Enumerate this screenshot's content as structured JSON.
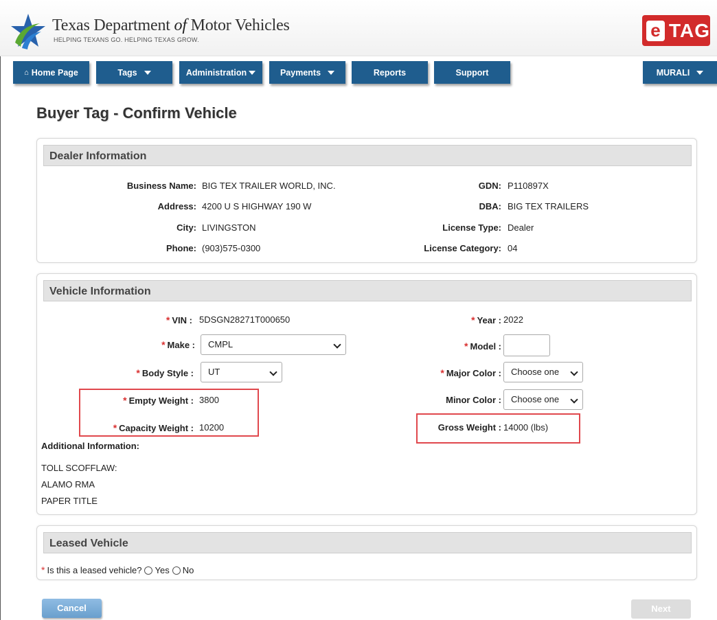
{
  "header": {
    "title_part1": "Texas Department ",
    "title_of": "of",
    "title_part2": " Motor Vehicles",
    "tagline": "HELPING TEXANS GO. HELPING TEXAS GROW.",
    "etag_e": "e",
    "etag_text": "TAG"
  },
  "nav": {
    "home": "Home Page",
    "home_icon": "⌂",
    "tags": "Tags",
    "administration": "Administration",
    "payments": "Payments",
    "reports": "Reports",
    "support": "Support",
    "user": "MURALI"
  },
  "page": {
    "title": "Buyer Tag - Confirm Vehicle"
  },
  "dealer": {
    "heading": "Dealer Information",
    "business_name_label": "Business Name:",
    "business_name": "BIG TEX TRAILER WORLD, INC.",
    "address_label": "Address:",
    "address": "4200 U S HIGHWAY 190 W",
    "city_label": "City:",
    "city": "LIVINGSTON",
    "phone_label": "Phone:",
    "phone": "(903)575-0300",
    "gdn_label": "GDN:",
    "gdn": "P110897X",
    "dba_label": "DBA:",
    "dba": "BIG TEX TRAILERS",
    "license_type_label": "License Type:",
    "license_type": "Dealer",
    "license_category_label": "License Category:",
    "license_category": "04"
  },
  "vehicle": {
    "heading": "Vehicle Information",
    "required_mark": "*",
    "vin_label": "VIN :",
    "vin": "5DSGN28271T000650",
    "make_label": "Make :",
    "make": "CMPL",
    "body_style_label": "Body Style :",
    "body_style": "UT",
    "empty_weight_label": "Empty Weight :",
    "empty_weight": "3800",
    "capacity_weight_label": "Capacity Weight :",
    "capacity_weight": "10200",
    "year_label": "Year :",
    "year": "2022",
    "model_label": "Model :",
    "model": "",
    "major_color_label": "Major Color :",
    "major_color": "Choose one",
    "minor_color_label": "Minor Color :",
    "minor_color": "Choose one",
    "gross_weight_label": "Gross Weight :",
    "gross_weight": "14000 (lbs)",
    "additional_label": "Additional Information:",
    "additional_items": [
      "TOLL SCOFFLAW:",
      "ALAMO RMA",
      "PAPER TITLE"
    ]
  },
  "leased": {
    "heading": "Leased Vehicle",
    "question": "Is this a leased vehicle?",
    "yes": "Yes",
    "no": "No"
  },
  "actions": {
    "cancel": "Cancel",
    "next": "Next"
  },
  "colors": {
    "nav": "#1f5d8e",
    "required": "#d93030",
    "highlight": "#e0474c",
    "etag": "#d22b2b"
  }
}
